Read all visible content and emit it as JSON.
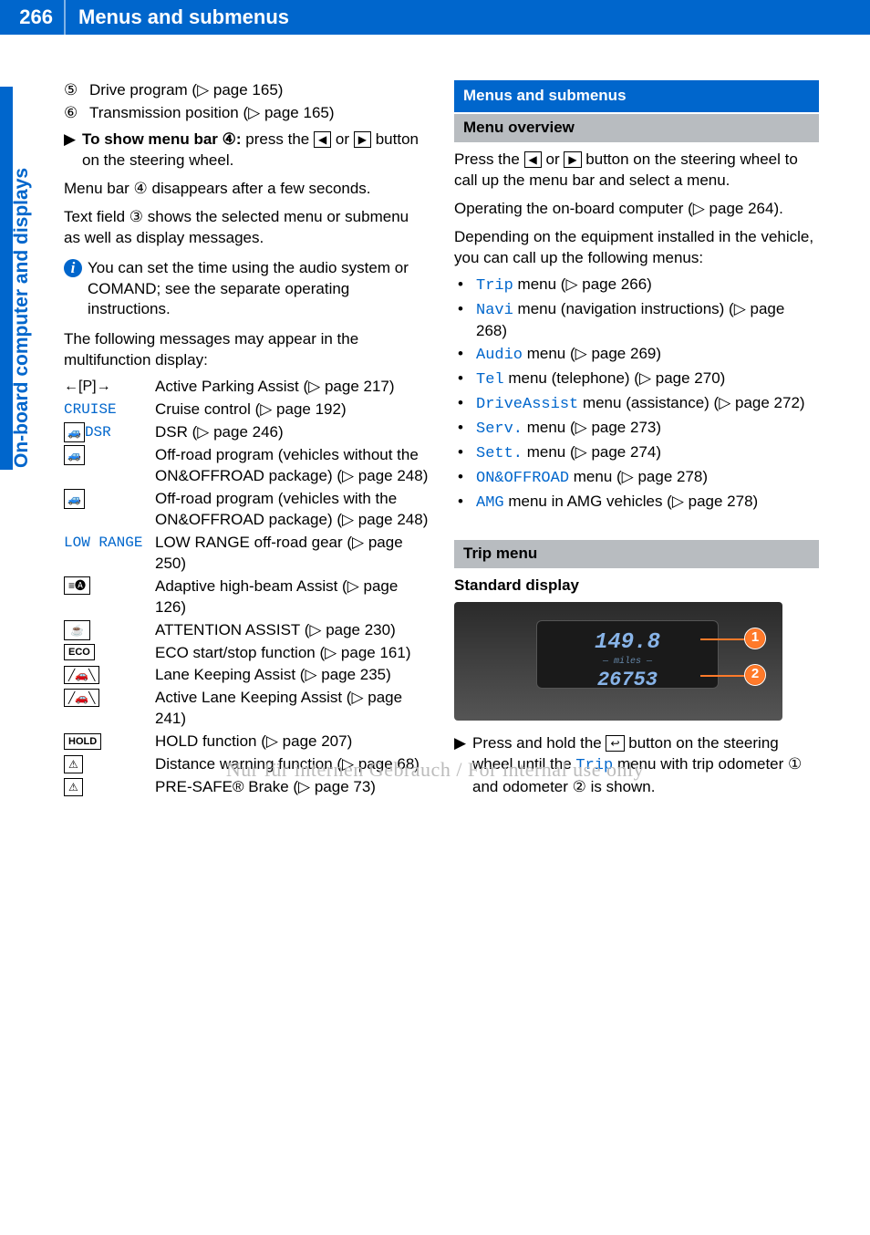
{
  "header": {
    "page": "266",
    "title": "Menus and submenus"
  },
  "sidetab": "On-board computer and displays",
  "left": {
    "items": [
      {
        "n": "⑤",
        "text": "Drive program (▷ page 165)"
      },
      {
        "n": "⑥",
        "text": "Transmission position (▷ page 165)"
      }
    ],
    "showMenuPre": "To show menu bar",
    "showMenuMid": ":",
    "showMenuAft": " press the ",
    "showMenuEnd": " button on the steering wheel.",
    "orWord": " or ",
    "menuBarLine": "Menu bar ④ disappears after a few seconds.",
    "textFieldLine": "Text field ③ shows the selected menu or submenu as well as display messages.",
    "infoNote": "You can set the time using the audio system or COMAND; see the separate operating instructions.",
    "followingMsg": "The following messages may appear in the multifunction display:",
    "symcircle4": "④",
    "symbols": [
      {
        "sym": "←[P]→",
        "cls": "",
        "desc": "Active Parking Assist (▷ page 217)"
      },
      {
        "sym": "CRUISE",
        "cls": "mono",
        "desc": "Cruise control (▷ page 192)"
      },
      {
        "sym": "DSR",
        "cls": "mono",
        "desc": "DSR (▷ page 246)",
        "prefixIcon": "car"
      },
      {
        "sym": "",
        "cls": "",
        "desc": "Off-road program (vehicles without the ON&OFFROAD package) (▷ page 248)",
        "onlyIcon": "car"
      },
      {
        "sym": "",
        "cls": "",
        "desc": "Off-road program (vehicles with the ON&OFFROAD package) (▷ page 248)",
        "onlyIcon": "car"
      },
      {
        "sym": "LOW RANGE",
        "cls": "mono",
        "desc": "LOW RANGE off-road gear (▷ page 250)"
      },
      {
        "sym": "",
        "cls": "",
        "desc": "Adaptive high-beam Assist (▷ page 126)",
        "onlyIcon": "beam"
      },
      {
        "sym": "",
        "cls": "",
        "desc": "ATTENTION ASSIST (▷ page 230)",
        "onlyIcon": "cup"
      },
      {
        "sym": "ECO",
        "cls": "",
        "desc": "ECO start/stop function (▷ page 161)",
        "boxed": true
      },
      {
        "sym": "",
        "cls": "",
        "desc": "Lane Keeping Assist (▷ page 235)",
        "onlyIcon": "lane"
      },
      {
        "sym": "",
        "cls": "",
        "desc": "Active Lane Keeping Assist (▷ page 241)",
        "onlyIcon": "lane"
      },
      {
        "sym": "HOLD",
        "cls": "",
        "desc": "HOLD function (▷ page 207)",
        "boxed": true
      },
      {
        "sym": "",
        "cls": "",
        "desc": "Distance warning function (▷ page 68)",
        "onlyIcon": "dist"
      },
      {
        "sym": "",
        "cls": "",
        "desc": "PRE-SAFE® Brake (▷ page 73)",
        "onlyIcon": "dist"
      }
    ]
  },
  "right": {
    "sectionTitle": "Menus and submenus",
    "menuOverview": "Menu overview",
    "pressThe": "Press the ",
    "orWord": " or ",
    "pressEnd": " button on the steering wheel to call up the menu bar and select a menu.",
    "operating": "Operating the on-board computer (▷ page 264).",
    "depending": "Depending on the equipment installed in the vehicle, you can call up the following menus:",
    "menus": [
      {
        "code": "Trip",
        "rest": " menu (▷ page 266)"
      },
      {
        "code": "Navi",
        "rest": " menu (navigation instructions) (▷ page 268)"
      },
      {
        "code": "Audio",
        "rest": " menu (▷ page 269)"
      },
      {
        "code": "Tel",
        "rest": " menu (telephone) (▷ page 270)"
      },
      {
        "code": "DriveAssist",
        "rest": " menu (assistance) (▷ page 272)"
      },
      {
        "code": "Serv.",
        "rest": " menu (▷ page 273)"
      },
      {
        "code": "Sett.",
        "rest": " menu (▷ page 274)"
      },
      {
        "code": "ON&OFFROAD",
        "rest": " menu (▷ page 278)"
      },
      {
        "code": "AMG",
        "rest": " menu in AMG vehicles (▷ page 278)"
      }
    ],
    "tripMenu": "Trip menu",
    "standardDisplay": "Standard display",
    "dash": {
      "v1": "149.8",
      "mid": "miles",
      "v2": "26753"
    },
    "callouts": {
      "c1": "1",
      "c2": "2"
    },
    "tripInstrA": "Press and hold the ",
    "tripInstrB": " button on the steering wheel until the ",
    "tripCode": "Trip",
    "tripInstrC": " menu with trip odometer ",
    "tripInstrD": " and odometer ",
    "tripInstrE": " is shown.",
    "circ1": "①",
    "circ2": "②"
  },
  "icons": {
    "left": "◀",
    "right": "▶",
    "back": "↩"
  },
  "watermark": "Nur für internen Gebrauch / For internal use only"
}
